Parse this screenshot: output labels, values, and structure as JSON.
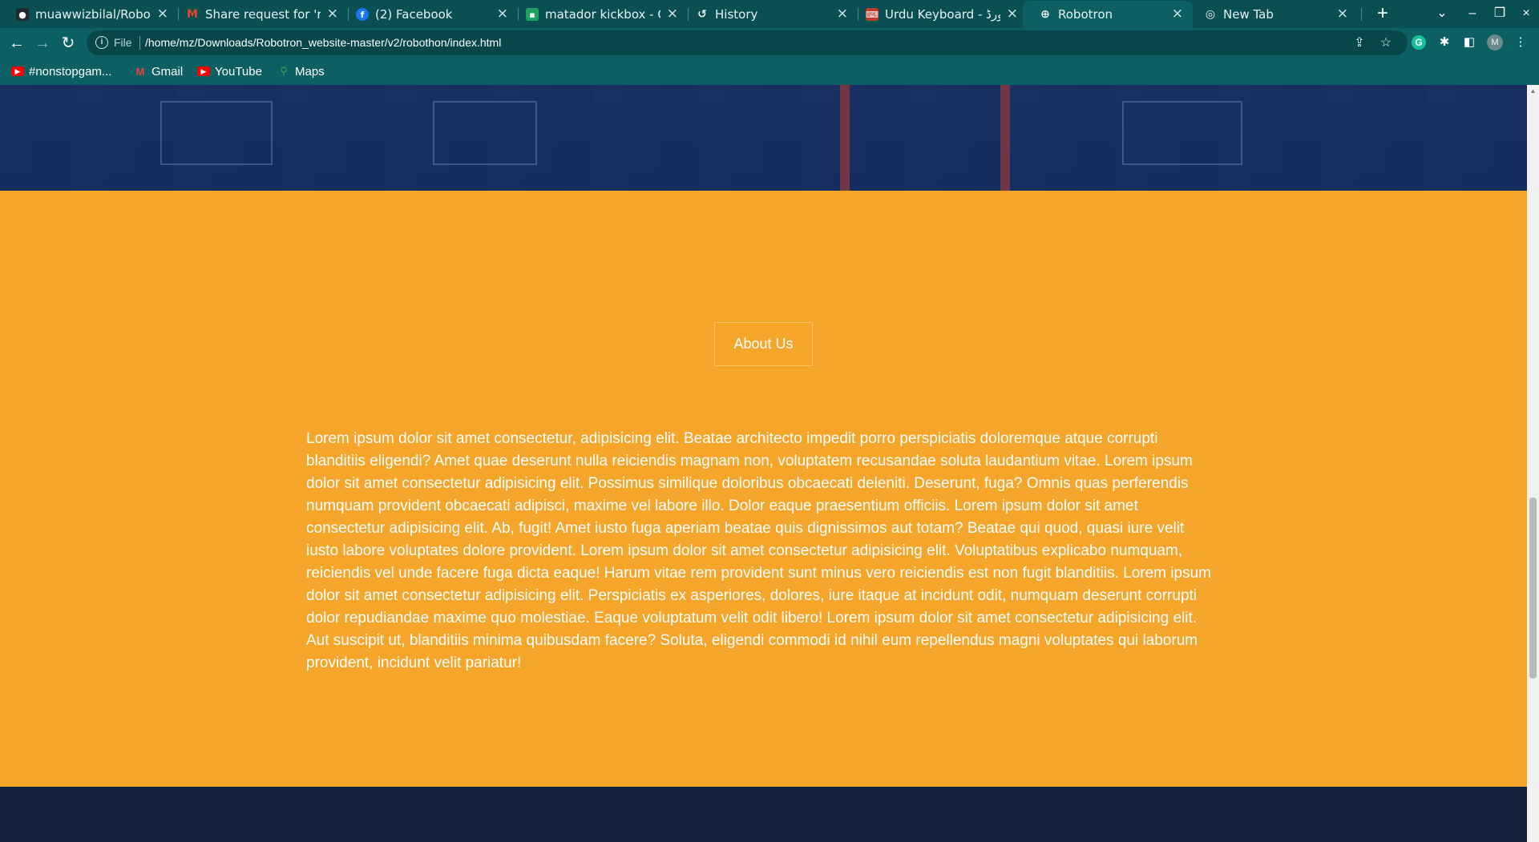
{
  "browser": {
    "tabs": [
      {
        "title": "muawwizbilal/Robotron",
        "icon": "github-icon",
        "active": false
      },
      {
        "title": "Share request for 'robothon'",
        "icon": "gmail-icon",
        "active": false
      },
      {
        "title": "(2) Facebook",
        "icon": "facebook-icon",
        "active": false
      },
      {
        "title": "matador kickbox - Chat",
        "icon": "chat-icon",
        "active": false
      },
      {
        "title": "History",
        "icon": "history-icon",
        "active": false
      },
      {
        "title": "Urdu Keyboard - اردو کی بورڈ",
        "icon": "keyboard-icon",
        "active": false
      },
      {
        "title": "Robotron",
        "icon": "globe-icon",
        "active": true
      },
      {
        "title": "New Tab",
        "icon": "chrome-icon",
        "active": false
      }
    ],
    "new_tab_label": "+",
    "address": {
      "scheme_label": "File",
      "url": "/home/mz/Downloads/Robotron_website-master/v2/robothon/index.html"
    },
    "profile_initial": "M",
    "extension_initial": "G",
    "bookmarks": [
      {
        "label": "#nonstopgam...",
        "icon": "youtube-icon"
      },
      {
        "label": "Gmail",
        "icon": "gmail-icon"
      },
      {
        "label": "YouTube",
        "icon": "youtube-icon"
      },
      {
        "label": "Maps",
        "icon": "maps-icon"
      }
    ]
  },
  "page": {
    "about": {
      "button_label": "About Us",
      "body": "Lorem ipsum dolor sit amet consectetur, adipisicing elit. Beatae architecto impedit porro perspiciatis doloremque atque corrupti blanditiis eligendi? Amet quae deserunt nulla reiciendis magnam non, voluptatem recusandae soluta laudantium vitae. Lorem ipsum dolor sit amet consectetur adipisicing elit. Possimus similique doloribus obcaecati deleniti. Deserunt, fuga? Omnis quas perferendis numquam provident obcaecati adipisci, maxime vel labore illo. Dolor eaque praesentium officiis. Lorem ipsum dolor sit amet consectetur adipisicing elit. Ab, fugit! Amet iusto fuga aperiam beatae quis dignissimos aut totam? Beatae qui quod, quasi iure velit iusto labore voluptates dolore provident. Lorem ipsum dolor sit amet consectetur adipisicing elit. Voluptatibus explicabo numquam, reiciendis vel unde facere fuga dicta eaque! Harum vitae rem provident sunt minus vero reiciendis est non fugit blanditiis. Lorem ipsum dolor sit amet consectetur adipisicing elit. Perspiciatis ex asperiores, dolores, iure itaque at incidunt odit, numquam deserunt corrupti dolor repudiandae maxime quo molestiae. Eaque voluptatum velit odit libero! Lorem ipsum dolor sit amet consectetur adipisicing elit. Aut suscipit ut, blanditiis minima quibusdam facere? Soluta, eligendi commodi id nihil eum repellendus magni voluptates qui laborum provident, incidunt velit pariatur!"
    }
  },
  "colors": {
    "chrome_bg": "#0c5f62",
    "tabstrip_bg": "#0a4f52",
    "about_bg": "#f5a52a",
    "hero_bg": "#162c60",
    "footer_bg": "#13213f"
  }
}
